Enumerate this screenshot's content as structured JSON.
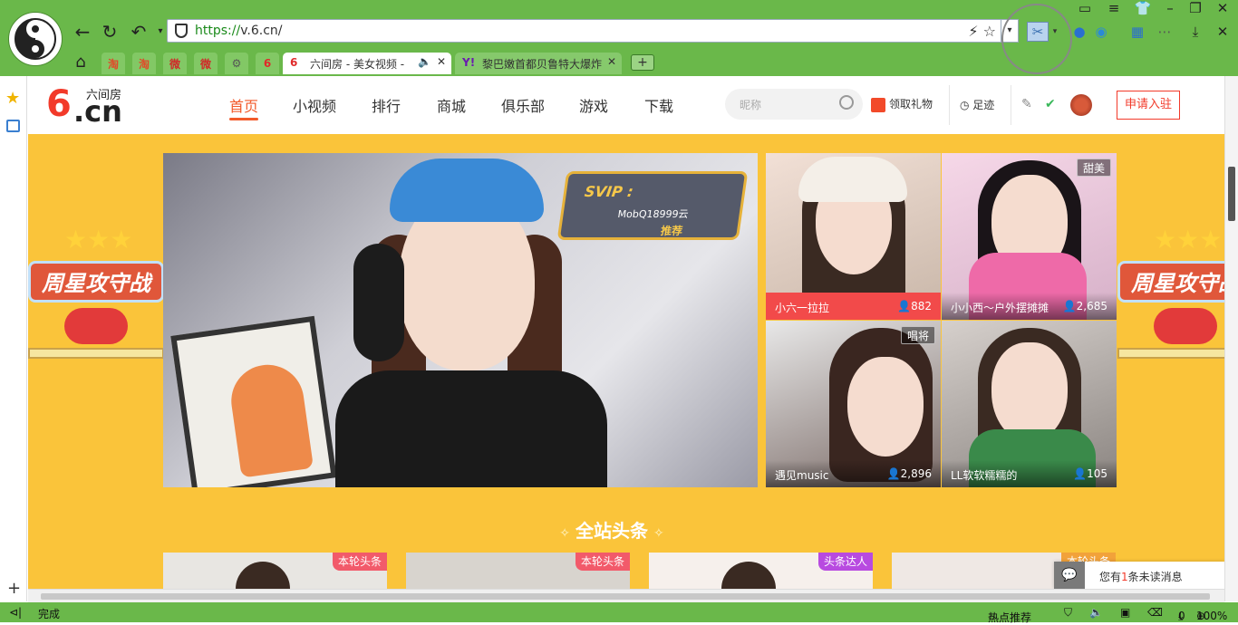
{
  "browser": {
    "url_scheme": "https://",
    "url_rest": "v.6.cn/",
    "tabs": [
      {
        "label": "六间房 - 美女视频 - ",
        "favicon": "6"
      },
      {
        "label": "黎巴嫩首都贝鲁特大爆炸",
        "favicon": "Y!"
      }
    ],
    "pinned_tabs": [
      "淘",
      "淘",
      "微",
      "微",
      "⚙",
      "6"
    ],
    "new_tab": "+"
  },
  "site": {
    "logo_num": "6",
    "logo_cn": ".cn",
    "logo_name": "六间房",
    "nav": [
      "首页",
      "小视频",
      "排行",
      "商城",
      "俱乐部",
      "游戏",
      "下载"
    ],
    "search_placeholder": "昵称",
    "gift": "领取礼物",
    "footprint": "足迹",
    "apply": "申请入驻"
  },
  "hero": {
    "svip_title": "SVIP :",
    "svip_name": "MobQ18999云",
    "svip_recommend": "推荐"
  },
  "rooms": [
    {
      "name": "小六一拉拉",
      "count": "882",
      "tag": ""
    },
    {
      "name": "小小西～户外摆摊摊",
      "count": "2,685",
      "tag": "甜美"
    },
    {
      "name": "遇见music",
      "count": "2,896",
      "tag": "唱将"
    },
    {
      "name": "LL软软糯糯的",
      "count": "105",
      "tag": ""
    }
  ],
  "ads": {
    "left": "周星攻守战",
    "right": "周星攻守战"
  },
  "section": {
    "title": "全站头条"
  },
  "headlines": [
    {
      "tag": "本轮头条",
      "color": "#f25a6a"
    },
    {
      "tag": "本轮头条",
      "color": "#f25a6a"
    },
    {
      "tag": "头条达人",
      "color": "#b84ae0"
    },
    {
      "tag": "本轮头条",
      "color": "#f2a23a"
    }
  ],
  "message": {
    "prefix": "您有",
    "num": "1",
    "suffix": "条未读消息"
  },
  "status": {
    "left": "完成",
    "hot": "热点推荐",
    "count": "0",
    "zoom": "100%"
  }
}
